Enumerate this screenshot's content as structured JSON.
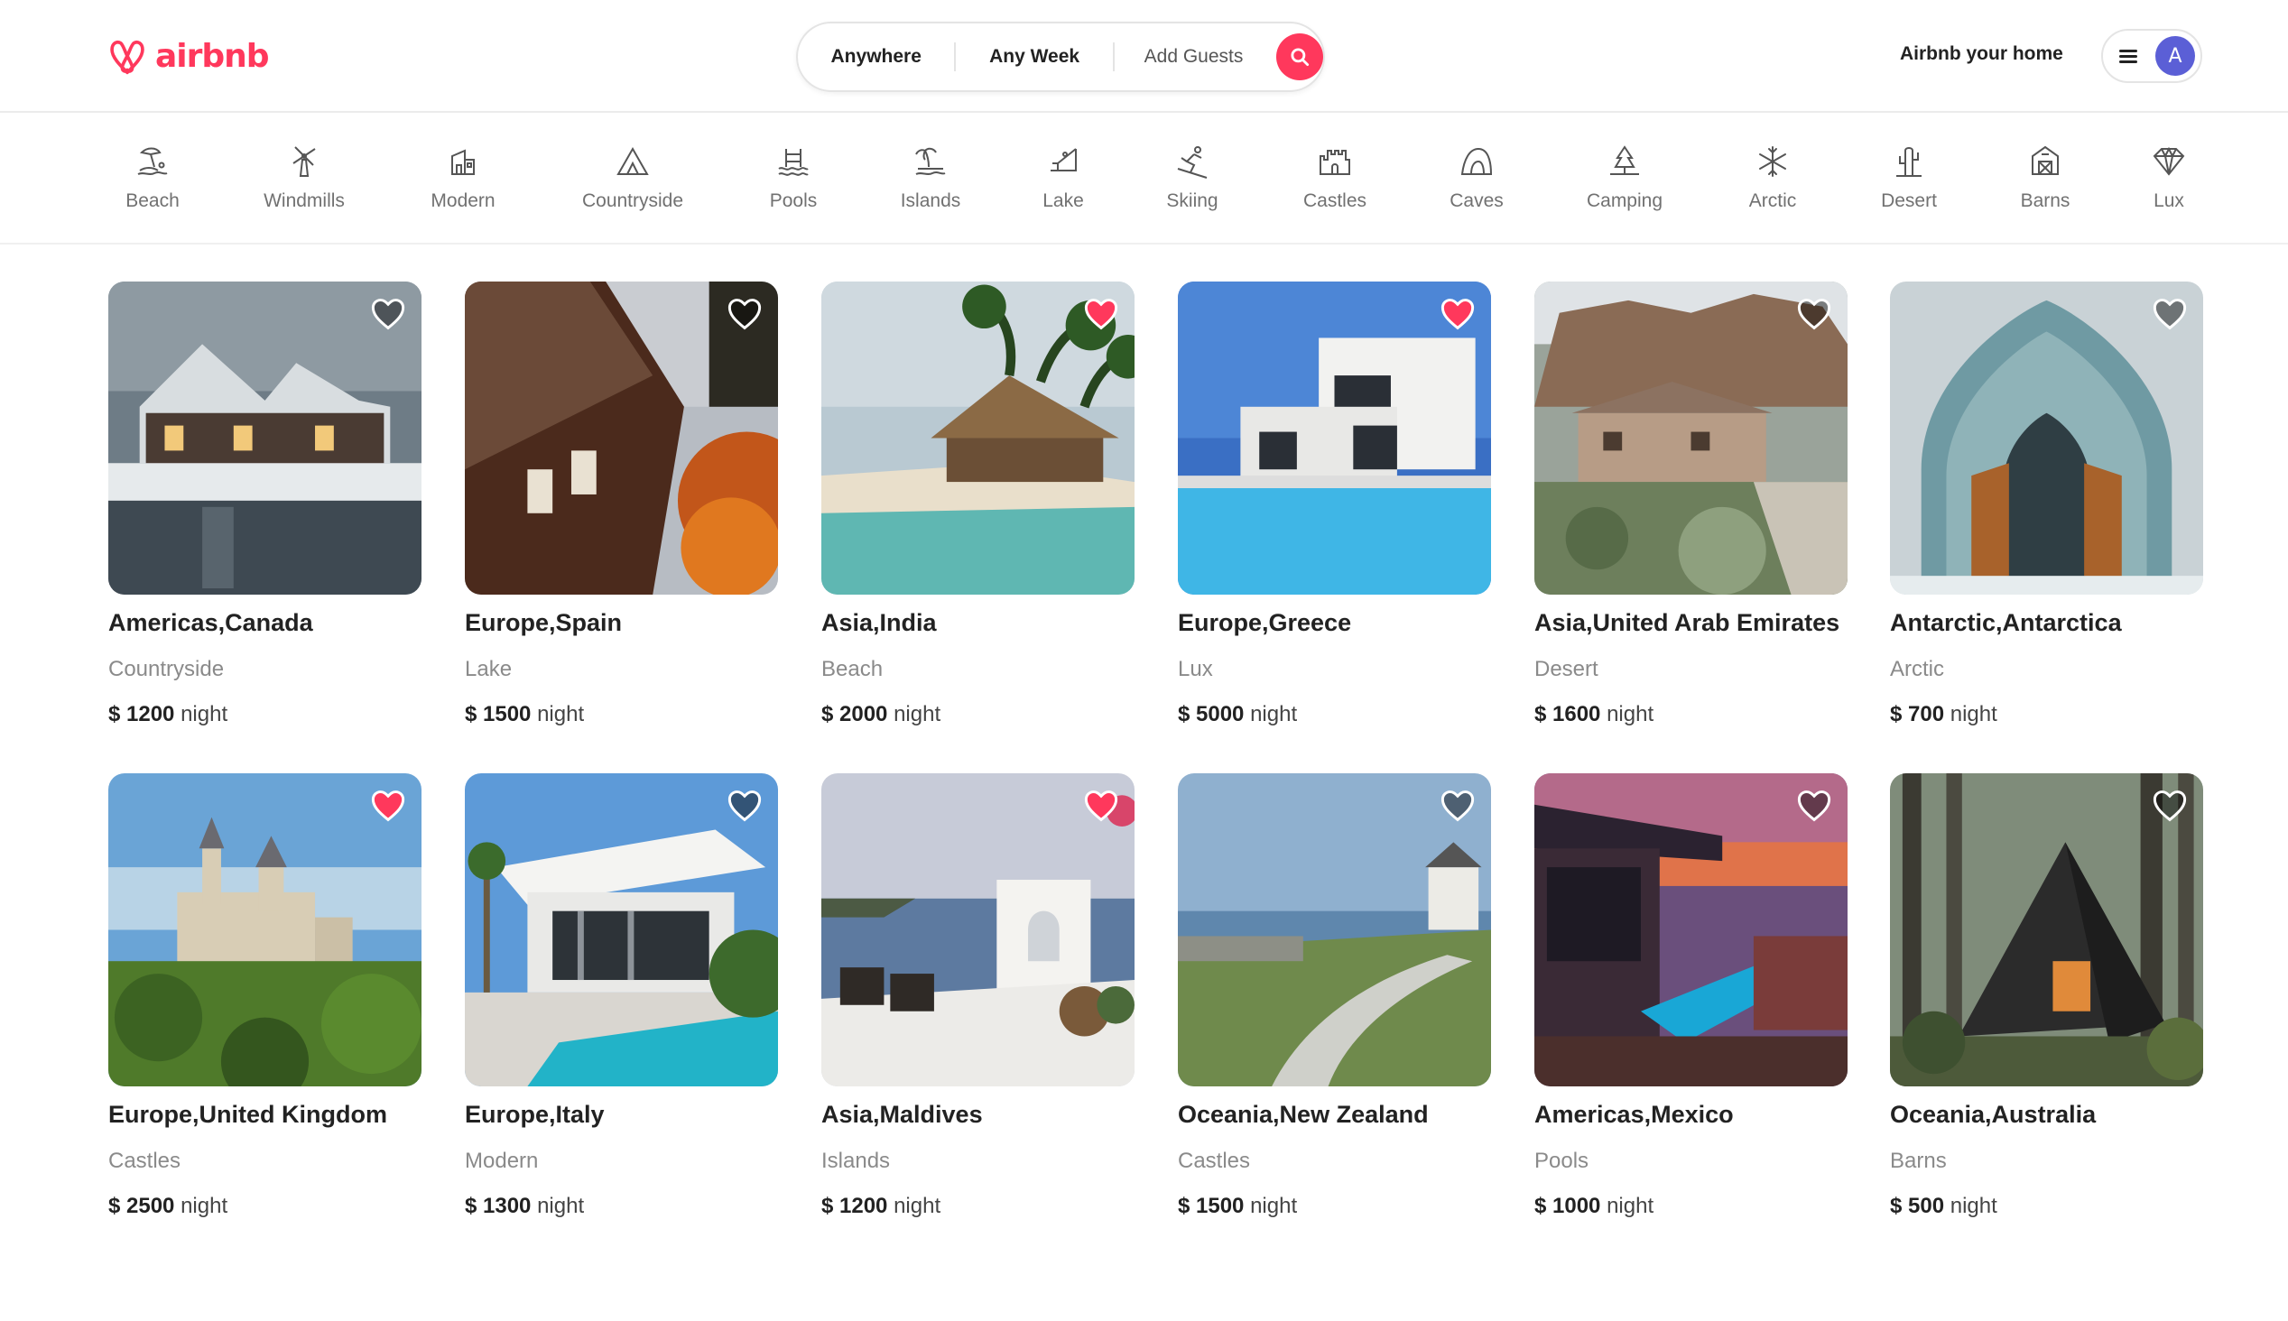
{
  "header": {
    "logo_text": "airbnb",
    "search": {
      "anywhere": "Anywhere",
      "any_week": "Any Week",
      "add_guests": "Add Guests"
    },
    "host_link": "Airbnb your home",
    "avatar_initial": "A",
    "brand_color": "#FF385C"
  },
  "categories": [
    {
      "label": "Beach",
      "icon": "beach-icon"
    },
    {
      "label": "Windmills",
      "icon": "windmill-icon"
    },
    {
      "label": "Modern",
      "icon": "modern-house-icon"
    },
    {
      "label": "Countryside",
      "icon": "mountain-icon"
    },
    {
      "label": "Pools",
      "icon": "pool-icon"
    },
    {
      "label": "Islands",
      "icon": "island-icon"
    },
    {
      "label": "Lake",
      "icon": "lake-icon"
    },
    {
      "label": "Skiing",
      "icon": "skiing-icon"
    },
    {
      "label": "Castles",
      "icon": "castle-icon"
    },
    {
      "label": "Caves",
      "icon": "cave-icon"
    },
    {
      "label": "Camping",
      "icon": "camping-icon"
    },
    {
      "label": "Arctic",
      "icon": "snowflake-icon"
    },
    {
      "label": "Desert",
      "icon": "cactus-icon"
    },
    {
      "label": "Barns",
      "icon": "barn-icon"
    },
    {
      "label": "Lux",
      "icon": "diamond-icon"
    }
  ],
  "listings": [
    {
      "location": "Americas,Canada",
      "category": "Countryside",
      "price": "$ 1200",
      "unit": "night",
      "favorite": false,
      "scene": "snowy house"
    },
    {
      "location": "Europe,Spain",
      "category": "Lake",
      "price": "$ 1500",
      "unit": "night",
      "favorite": false,
      "scene": "wooden cabin lake"
    },
    {
      "location": "Asia,India",
      "category": "Beach",
      "price": "$ 2000",
      "unit": "night",
      "favorite": true,
      "scene": "beach hut palms"
    },
    {
      "location": "Europe,Greece",
      "category": "Lux",
      "price": "$ 5000",
      "unit": "night",
      "favorite": true,
      "scene": "modern villa pool"
    },
    {
      "location": "Asia,United Arab Emirates",
      "category": "Desert",
      "price": "$ 1600",
      "unit": "night",
      "favorite": false,
      "scene": "desert house cliff"
    },
    {
      "location": "Antarctic,Antarctica",
      "category": "Arctic",
      "price": "$ 700",
      "unit": "night",
      "favorite": false,
      "scene": "ice arch door"
    },
    {
      "location": "Europe,United Kingdom",
      "category": "Castles",
      "price": "$ 2500",
      "unit": "night",
      "favorite": true,
      "scene": "castle forest"
    },
    {
      "location": "Europe,Italy",
      "category": "Modern",
      "price": "$ 1300",
      "unit": "night",
      "favorite": false,
      "scene": "white house pool"
    },
    {
      "location": "Asia,Maldives",
      "category": "Islands",
      "price": "$ 1200",
      "unit": "night",
      "favorite": true,
      "scene": "terrace sea"
    },
    {
      "location": "Oceania,New Zealand",
      "category": "Castles",
      "price": "$ 1500",
      "unit": "night",
      "favorite": false,
      "scene": "coastal path"
    },
    {
      "location": "Americas,Mexico",
      "category": "Pools",
      "price": "$ 1000",
      "unit": "night",
      "favorite": false,
      "scene": "sunset pool"
    },
    {
      "location": "Oceania,Australia",
      "category": "Barns",
      "price": "$ 500",
      "unit": "night",
      "favorite": false,
      "scene": "a-frame forest"
    }
  ]
}
